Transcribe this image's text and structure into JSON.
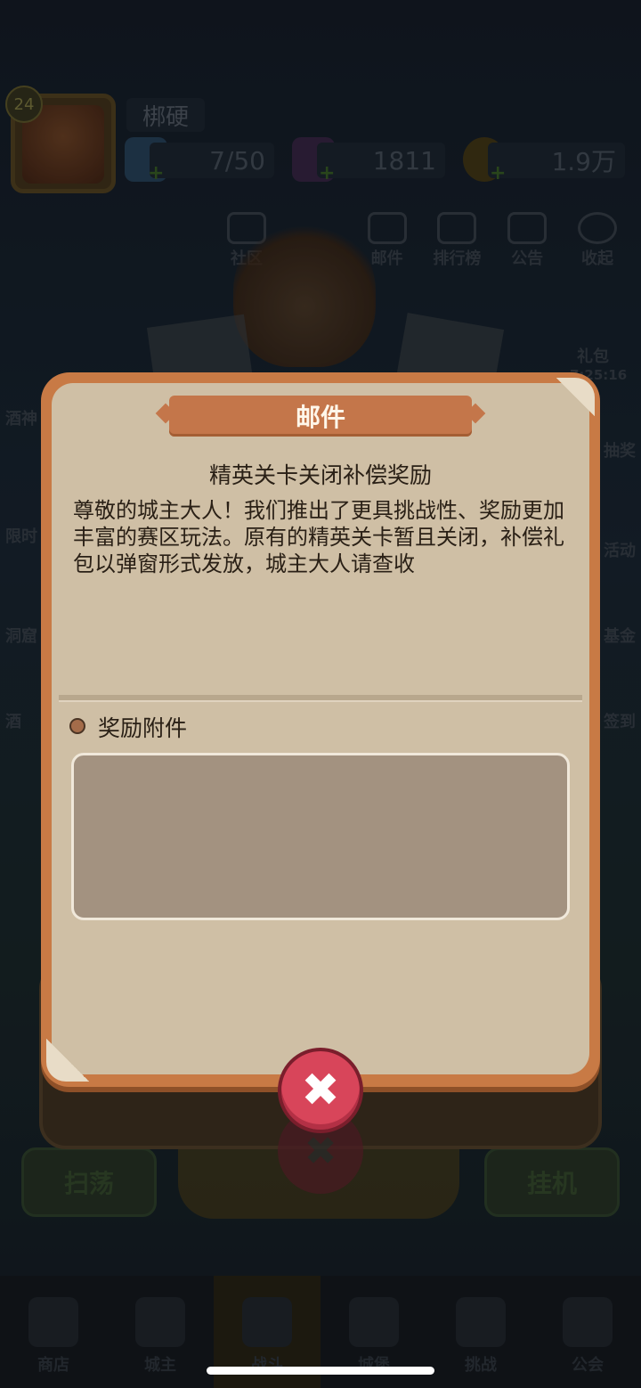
{
  "player": {
    "level": "24",
    "name": "梆硬",
    "energy": "7/50",
    "gems": "1811",
    "gold": "1.9万"
  },
  "top_nav": [
    {
      "label": "社区",
      "icon": "house-star-icon"
    },
    {
      "label": "",
      "icon": "hidden-icon"
    },
    {
      "label": "邮件",
      "icon": "mail-icon"
    },
    {
      "label": "排行榜",
      "icon": "bar-chart-icon"
    },
    {
      "label": "公告",
      "icon": "megaphone-icon"
    },
    {
      "label": "收起",
      "icon": "play-collapse-icon"
    }
  ],
  "side_right": {
    "gift_label": "礼包",
    "gift_time": "7:25:16",
    "lottery": "抽奖",
    "activity": "活动",
    "fund": "基金",
    "signin": "签到"
  },
  "side_left": [
    "酒神",
    "限时",
    "洞窟",
    "酒"
  ],
  "actions": {
    "sweep": "扫荡",
    "idle": "挂机"
  },
  "bottom_nav": [
    {
      "label": "商店",
      "icon": "shop-icon",
      "active": false
    },
    {
      "label": "城主",
      "icon": "crown-icon",
      "active": false
    },
    {
      "label": "战斗",
      "icon": "swords-icon",
      "active": true
    },
    {
      "label": "城堡",
      "icon": "castle-icon",
      "active": false
    },
    {
      "label": "挑战",
      "icon": "demon-icon",
      "active": false
    },
    {
      "label": "公会",
      "icon": "banner-icon",
      "active": false
    }
  ],
  "dialog": {
    "title": "邮件",
    "subject": "精英关卡关闭补偿奖励",
    "body": "尊敬的城主大人！我们推出了更具挑战性、奖励更加丰富的赛区玩法。原有的精英关卡暂且关闭，补偿礼包以弹窗形式发放，城主大人请查收",
    "attachments_label": "奖励附件",
    "close_symbol": "✖"
  },
  "colors": {
    "dialog_frame": "#c87a45",
    "dialog_panel": "#cfbfa5",
    "title_ribbon": "#c4764a",
    "close_button": "#d8455a",
    "attachment_box": "#a39280"
  }
}
